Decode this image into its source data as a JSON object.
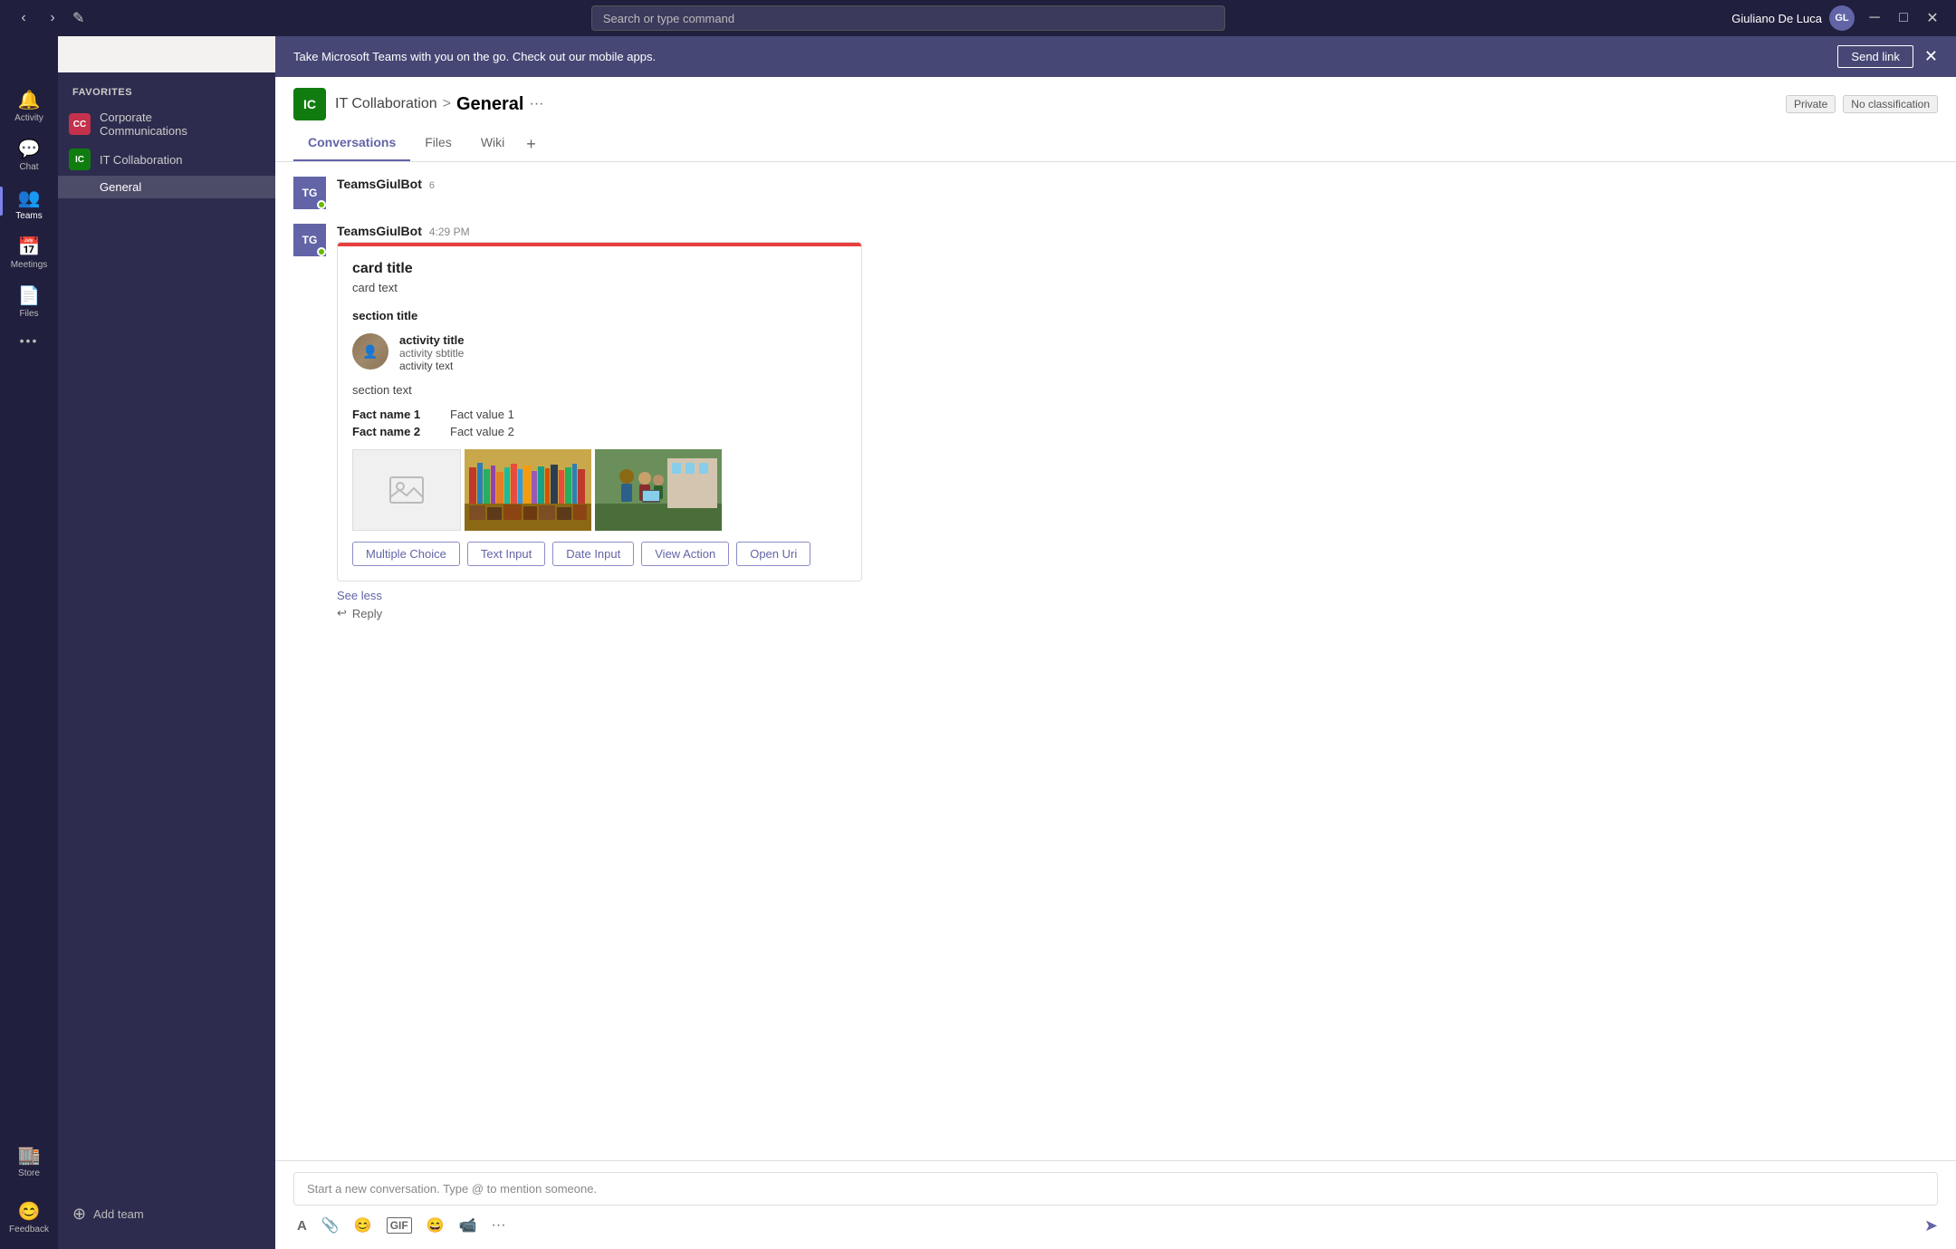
{
  "titlebar": {
    "search_placeholder": "Search or type command",
    "user_name": "Giuliano De Luca",
    "nav_back": "‹",
    "nav_forward": "›",
    "compose_icon": "✎",
    "minimize": "─",
    "maximize": "□",
    "close": "✕"
  },
  "sidebar_icons": [
    {
      "id": "activity",
      "label": "Activity",
      "glyph": "🔔",
      "active": false
    },
    {
      "id": "chat",
      "label": "Chat",
      "glyph": "💬",
      "active": false
    },
    {
      "id": "teams",
      "label": "Teams",
      "glyph": "👥",
      "active": true
    },
    {
      "id": "meetings",
      "label": "Meetings",
      "glyph": "📅",
      "active": false
    },
    {
      "id": "files",
      "label": "Files",
      "glyph": "📄",
      "active": false
    },
    {
      "id": "more",
      "label": "...",
      "glyph": "···",
      "active": false
    }
  ],
  "sidebar_bottom_icons": [
    {
      "id": "store",
      "label": "Store",
      "glyph": "🏬"
    },
    {
      "id": "feedback",
      "label": "Feedback",
      "glyph": "😊"
    }
  ],
  "sidebar": {
    "favorites_label": "Favorites",
    "teams": [
      {
        "id": "cc",
        "icon_text": "CC",
        "name": "Corporate Communications",
        "has_more": true
      },
      {
        "id": "ic",
        "icon_text": "IC",
        "name": "IT Collaboration",
        "has_more": true,
        "channels": [
          {
            "id": "general",
            "name": "General",
            "active": true
          }
        ]
      }
    ],
    "add_team_label": "Add team"
  },
  "banner": {
    "text": "Take Microsoft Teams with you on the go. Check out our mobile apps.",
    "send_link_label": "Send link",
    "close": "✕"
  },
  "channel": {
    "team_icon": "IC",
    "team_name": "IT Collaboration",
    "separator": ">",
    "channel_name": "General",
    "ellipsis": "···",
    "tag_private": "Private",
    "tag_classification": "No classification",
    "tabs": [
      {
        "id": "conversations",
        "label": "Conversations",
        "active": true
      },
      {
        "id": "files",
        "label": "Files",
        "active": false
      },
      {
        "id": "wiki",
        "label": "Wiki",
        "active": false
      }
    ],
    "tab_add": "+"
  },
  "message": {
    "sender": "TeamsGiulBot",
    "time": "4:29 PM",
    "bot_initials": "TG",
    "card": {
      "top_border_color": "#e83e3e",
      "title": "card title",
      "text": "card text",
      "section_title": "section title",
      "activity_title": "activity title",
      "activity_subtitle": "activity sbtitle",
      "activity_text": "activity text",
      "section_text": "section text",
      "facts": [
        {
          "name": "Fact name 1",
          "value": "Fact value 1"
        },
        {
          "name": "Fact name 2",
          "value": "Fact value 2"
        }
      ],
      "actions": [
        {
          "id": "multiple-choice",
          "label": "Multiple Choice"
        },
        {
          "id": "text-input",
          "label": "Text Input"
        },
        {
          "id": "date-input",
          "label": "Date Input"
        },
        {
          "id": "view-action",
          "label": "View Action"
        },
        {
          "id": "open-uri",
          "label": "Open Uri"
        }
      ],
      "see_less": "See less"
    },
    "reply_label": "Reply"
  },
  "new_conversation": {
    "placeholder": "Start a new conversation. Type @ to mention someone.",
    "toolbar": {
      "format": "A",
      "attach": "📎",
      "emoji": "😊",
      "gif": "GIF",
      "sticker": "😄",
      "video": "📹",
      "more": "···",
      "send": "➤"
    }
  }
}
